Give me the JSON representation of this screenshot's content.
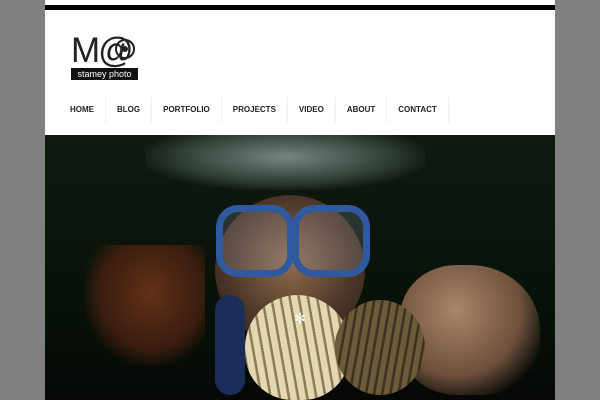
{
  "logo": {
    "monogram": "M@",
    "tagline": "stamey photo"
  },
  "nav": {
    "items": [
      {
        "label": "HOME"
      },
      {
        "label": "BLOG"
      },
      {
        "label": "PORTFOLIO"
      },
      {
        "label": "PROJECTS"
      },
      {
        "label": "VIDEO"
      },
      {
        "label": "ABOUT"
      },
      {
        "label": "CONTACT"
      }
    ]
  },
  "hero": {
    "loading_icon": "spinner-icon"
  },
  "colors": {
    "background": "#808080",
    "topbar": "#000000",
    "mask_frame": "#2f5aa0"
  }
}
